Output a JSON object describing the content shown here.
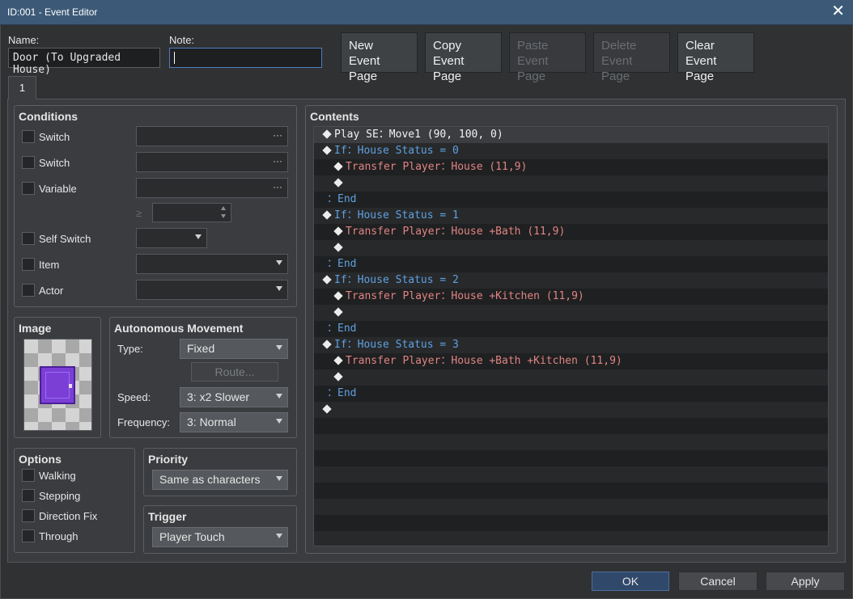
{
  "window": {
    "title": "ID:001 - Event Editor",
    "close_glyph": "✕"
  },
  "header": {
    "name_label": "Name:",
    "name_value": "Door (To Upgraded House)",
    "note_label": "Note:",
    "note_value": ""
  },
  "page_buttons": [
    {
      "line1": "New",
      "line2": "Event Page",
      "enabled": true
    },
    {
      "line1": "Copy",
      "line2": "Event Page",
      "enabled": true
    },
    {
      "line1": "Paste",
      "line2": "Event Page",
      "enabled": false
    },
    {
      "line1": "Delete",
      "line2": "Event Page",
      "enabled": false
    },
    {
      "line1": "Clear",
      "line2": "Event Page",
      "enabled": true
    }
  ],
  "tabs": [
    {
      "label": "1"
    }
  ],
  "conditions": {
    "title": "Conditions",
    "switch1_label": "Switch",
    "switch2_label": "Switch",
    "variable_label": "Variable",
    "ge_glyph": "≥",
    "self_switch_label": "Self Switch",
    "item_label": "Item",
    "actor_label": "Actor",
    "dots": "···"
  },
  "image": {
    "title": "Image",
    "icon": "door-icon"
  },
  "autonomous_movement": {
    "title": "Autonomous Movement",
    "type_label": "Type:",
    "type_value": "Fixed",
    "route_button": "Route...",
    "speed_label": "Speed:",
    "speed_value": "3: x2 Slower",
    "frequency_label": "Frequency:",
    "frequency_value": "3: Normal"
  },
  "options": {
    "title": "Options",
    "walking": "Walking",
    "stepping": "Stepping",
    "direction_fix": "Direction Fix",
    "through": "Through"
  },
  "priority": {
    "title": "Priority",
    "value": "Same as characters"
  },
  "trigger": {
    "title": "Trigger",
    "value": "Player Touch"
  },
  "contents": {
    "title": "Contents",
    "lines": [
      {
        "indent": 0,
        "diamond": true,
        "text": "Play SE：Move1 (90, 100, 0)",
        "color": "white"
      },
      {
        "indent": 0,
        "diamond": true,
        "text": "If：House Status = 0",
        "color": "blue"
      },
      {
        "indent": 1,
        "diamond": true,
        "text": "Transfer Player：House (11,9)",
        "color": "red"
      },
      {
        "indent": 1,
        "diamond": true,
        "text": "",
        "color": "white"
      },
      {
        "indent": 0,
        "diamond": false,
        "text": "：End",
        "color": "blue"
      },
      {
        "indent": 0,
        "diamond": true,
        "text": "If：House Status = 1",
        "color": "blue"
      },
      {
        "indent": 1,
        "diamond": true,
        "text": "Transfer Player：House +Bath (11,9)",
        "color": "red"
      },
      {
        "indent": 1,
        "diamond": true,
        "text": "",
        "color": "white"
      },
      {
        "indent": 0,
        "diamond": false,
        "text": "：End",
        "color": "blue"
      },
      {
        "indent": 0,
        "diamond": true,
        "text": "If：House Status = 2",
        "color": "blue"
      },
      {
        "indent": 1,
        "diamond": true,
        "text": "Transfer Player：House +Kitchen (11,9)",
        "color": "red"
      },
      {
        "indent": 1,
        "diamond": true,
        "text": "",
        "color": "white"
      },
      {
        "indent": 0,
        "diamond": false,
        "text": "：End",
        "color": "blue"
      },
      {
        "indent": 0,
        "diamond": true,
        "text": "If：House Status = 3",
        "color": "blue"
      },
      {
        "indent": 1,
        "diamond": true,
        "text": "Transfer Player：House +Bath +Kitchen (11,9)",
        "color": "red"
      },
      {
        "indent": 1,
        "diamond": true,
        "text": "",
        "color": "white"
      },
      {
        "indent": 0,
        "diamond": false,
        "text": "：End",
        "color": "blue"
      },
      {
        "indent": 0,
        "diamond": true,
        "text": "",
        "color": "white"
      }
    ]
  },
  "footer": {
    "ok": "OK",
    "cancel": "Cancel",
    "apply": "Apply"
  }
}
